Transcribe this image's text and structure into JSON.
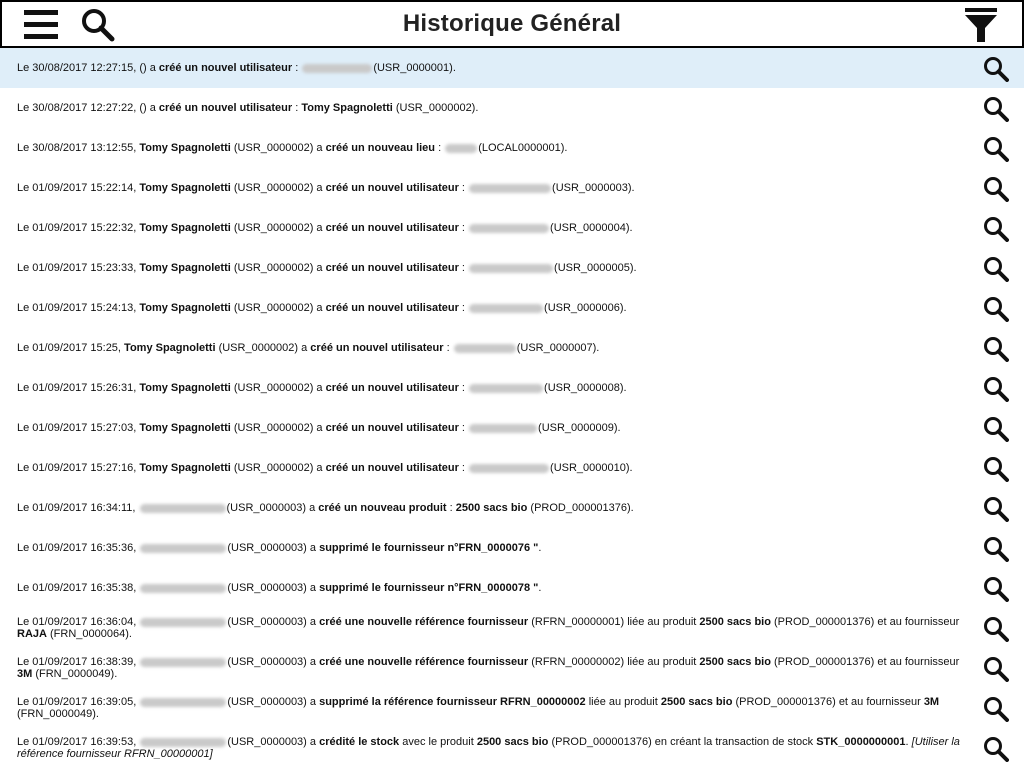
{
  "header": {
    "title": "Historique Général",
    "menu_icon": "hamburger-menu-icon",
    "search_icon": "search-icon",
    "filter_icon": "filter-icon"
  },
  "entries": [
    {
      "selected": true,
      "parts": [
        {
          "t": "Le 30/08/2017 12:27:15,  () a "
        },
        {
          "b": "créé un nouvel utilisateur"
        },
        {
          "t": " : "
        },
        {
          "r": 70
        },
        {
          "t": "(USR_0000001)."
        }
      ]
    },
    {
      "parts": [
        {
          "t": "Le 30/08/2017 12:27:22,  () a "
        },
        {
          "b": "créé un nouvel utilisateur"
        },
        {
          "t": " : "
        },
        {
          "b": "Tomy Spagnoletti"
        },
        {
          "t": " (USR_0000002)."
        }
      ]
    },
    {
      "parts": [
        {
          "t": "Le 30/08/2017 13:12:55, "
        },
        {
          "b": "Tomy Spagnoletti"
        },
        {
          "t": " (USR_0000002) a "
        },
        {
          "b": "créé un nouveau lieu"
        },
        {
          "t": " : "
        },
        {
          "r": 32
        },
        {
          "t": "(LOCAL0000001)."
        }
      ]
    },
    {
      "parts": [
        {
          "t": "Le 01/09/2017 15:22:14, "
        },
        {
          "b": "Tomy Spagnoletti"
        },
        {
          "t": " (USR_0000002) a "
        },
        {
          "b": "créé un nouvel utilisateur"
        },
        {
          "t": " : "
        },
        {
          "r": 82
        },
        {
          "t": "(USR_0000003)."
        }
      ]
    },
    {
      "parts": [
        {
          "t": "Le 01/09/2017 15:22:32, "
        },
        {
          "b": "Tomy Spagnoletti"
        },
        {
          "t": " (USR_0000002) a "
        },
        {
          "b": "créé un nouvel utilisateur"
        },
        {
          "t": " : "
        },
        {
          "r": 80
        },
        {
          "t": "(USR_0000004)."
        }
      ]
    },
    {
      "parts": [
        {
          "t": "Le 01/09/2017 15:23:33, "
        },
        {
          "b": "Tomy Spagnoletti"
        },
        {
          "t": " (USR_0000002) a "
        },
        {
          "b": "créé un nouvel utilisateur"
        },
        {
          "t": " : "
        },
        {
          "r": 84
        },
        {
          "t": "(USR_0000005)."
        }
      ]
    },
    {
      "parts": [
        {
          "t": "Le 01/09/2017 15:24:13, "
        },
        {
          "b": "Tomy Spagnoletti"
        },
        {
          "t": " (USR_0000002) a "
        },
        {
          "b": "créé un nouvel utilisateur"
        },
        {
          "t": " : "
        },
        {
          "r": 74
        },
        {
          "t": "(USR_0000006)."
        }
      ]
    },
    {
      "parts": [
        {
          "t": "Le 01/09/2017 15:25, "
        },
        {
          "b": "Tomy Spagnoletti"
        },
        {
          "t": " (USR_0000002) a "
        },
        {
          "b": "créé un nouvel utilisateur"
        },
        {
          "t": " : "
        },
        {
          "r": 62
        },
        {
          "t": "(USR_0000007)."
        }
      ]
    },
    {
      "parts": [
        {
          "t": "Le 01/09/2017 15:26:31, "
        },
        {
          "b": "Tomy Spagnoletti"
        },
        {
          "t": " (USR_0000002) a "
        },
        {
          "b": "créé un nouvel utilisateur"
        },
        {
          "t": " : "
        },
        {
          "r": 74
        },
        {
          "t": "(USR_0000008)."
        }
      ]
    },
    {
      "parts": [
        {
          "t": "Le 01/09/2017 15:27:03, "
        },
        {
          "b": "Tomy Spagnoletti"
        },
        {
          "t": " (USR_0000002) a "
        },
        {
          "b": "créé un nouvel utilisateur"
        },
        {
          "t": " : "
        },
        {
          "r": 68
        },
        {
          "t": "(USR_0000009)."
        }
      ]
    },
    {
      "parts": [
        {
          "t": "Le 01/09/2017 15:27:16, "
        },
        {
          "b": "Tomy Spagnoletti"
        },
        {
          "t": " (USR_0000002) a "
        },
        {
          "b": "créé un nouvel utilisateur"
        },
        {
          "t": " : "
        },
        {
          "r": 80
        },
        {
          "t": "(USR_0000010)."
        }
      ]
    },
    {
      "parts": [
        {
          "t": "Le 01/09/2017 16:34:11, "
        },
        {
          "r": 86
        },
        {
          "t": "(USR_0000003) a "
        },
        {
          "b": "créé un nouveau produit"
        },
        {
          "t": " : "
        },
        {
          "b": "2500 sacs bio"
        },
        {
          "t": " (PROD_000001376)."
        }
      ]
    },
    {
      "parts": [
        {
          "t": "Le 01/09/2017 16:35:36, "
        },
        {
          "r": 86
        },
        {
          "t": "(USR_0000003) a "
        },
        {
          "b": "supprimé le fournisseur n°FRN_0000076 \""
        },
        {
          "t": "."
        }
      ]
    },
    {
      "parts": [
        {
          "t": "Le 01/09/2017 16:35:38, "
        },
        {
          "r": 86
        },
        {
          "t": "(USR_0000003) a "
        },
        {
          "b": "supprimé le fournisseur n°FRN_0000078 \""
        },
        {
          "t": "."
        }
      ]
    },
    {
      "parts": [
        {
          "t": "Le 01/09/2017 16:36:04, "
        },
        {
          "r": 86
        },
        {
          "t": "(USR_0000003) a "
        },
        {
          "b": "créé une nouvelle référence fournisseur"
        },
        {
          "t": " (RFRN_00000001) liée au produit "
        },
        {
          "b": "2500 sacs bio"
        },
        {
          "t": " (PROD_000001376) et au fournisseur "
        },
        {
          "b": "RAJA"
        },
        {
          "t": "  (FRN_0000064)."
        }
      ]
    },
    {
      "parts": [
        {
          "t": "Le 01/09/2017 16:38:39, "
        },
        {
          "r": 86
        },
        {
          "t": "(USR_0000003) a "
        },
        {
          "b": "créé une nouvelle référence fournisseur"
        },
        {
          "t": " (RFRN_00000002) liée au produit "
        },
        {
          "b": "2500 sacs bio"
        },
        {
          "t": " (PROD_000001376) et au fournisseur "
        },
        {
          "b": "3M"
        },
        {
          "t": " (FRN_0000049)."
        }
      ]
    },
    {
      "parts": [
        {
          "t": "Le 01/09/2017 16:39:05, "
        },
        {
          "r": 86
        },
        {
          "t": "(USR_0000003) a "
        },
        {
          "b": "supprimé la référence fournisseur RFRN_00000002"
        },
        {
          "t": " liée au produit "
        },
        {
          "b": "2500 sacs bio"
        },
        {
          "t": " (PROD_000001376) et au fournisseur "
        },
        {
          "b": "3M"
        },
        {
          "t": " (FRN_0000049)."
        }
      ]
    },
    {
      "parts": [
        {
          "t": "Le 01/09/2017 16:39:53, "
        },
        {
          "r": 86
        },
        {
          "t": "(USR_0000003) a "
        },
        {
          "b": "crédité le stock"
        },
        {
          "t": " avec le produit "
        },
        {
          "b": "2500 sacs bio"
        },
        {
          "t": " (PROD_000001376) en créant la transaction de stock "
        },
        {
          "b": "STK_0000000001"
        },
        {
          "t": ". "
        },
        {
          "i": "[Utiliser la référence fournisseur RFRN_00000001]"
        }
      ]
    }
  ],
  "row_action_icon": "magnifier-icon",
  "colors": {
    "selected_row": "#dfeef9",
    "text": "#111111",
    "border": "#000000"
  }
}
